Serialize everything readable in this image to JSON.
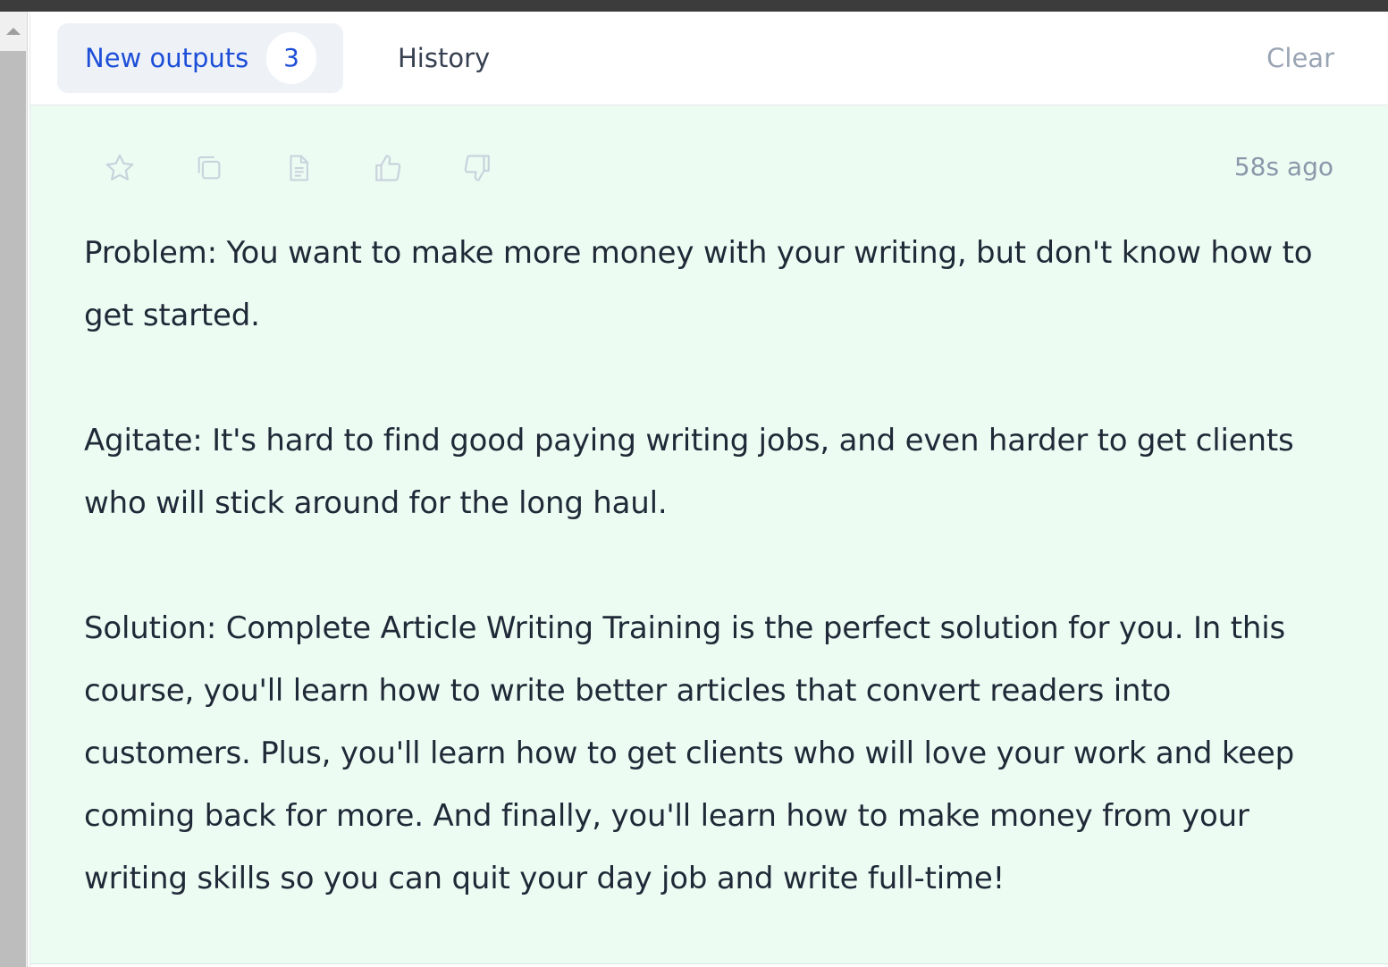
{
  "tabs": {
    "new_outputs": {
      "label": "New outputs",
      "count": "3"
    },
    "history": {
      "label": "History"
    },
    "clear": {
      "label": "Clear"
    }
  },
  "output": {
    "timestamp": "58s ago",
    "actions": [
      {
        "name": "star-icon"
      },
      {
        "name": "copy-icon"
      },
      {
        "name": "document-icon"
      },
      {
        "name": "thumbs-up-icon"
      },
      {
        "name": "thumbs-down-icon"
      }
    ],
    "paragraphs": [
      "Problem: You want to make more money with your writing, but don't know how to get started.",
      "Agitate: It's hard to find good paying writing jobs, and even harder to get clients who will stick around for the long haul.",
      "Solution: Complete Article Writing Training is the perfect solution for you. In this course, you'll learn how to write better articles that convert readers into customers. Plus, you'll learn how to get clients who will love your work and keep coming back for more. And finally, you'll learn how to make money from your writing skills so you can quit your day job and write full-time!"
    ]
  },
  "colors": {
    "accent": "#1d4ed8",
    "card_background": "#edfcf3",
    "tab_active_background": "#eef2f7",
    "text": "#1f2937",
    "muted": "#9aa5b4"
  }
}
